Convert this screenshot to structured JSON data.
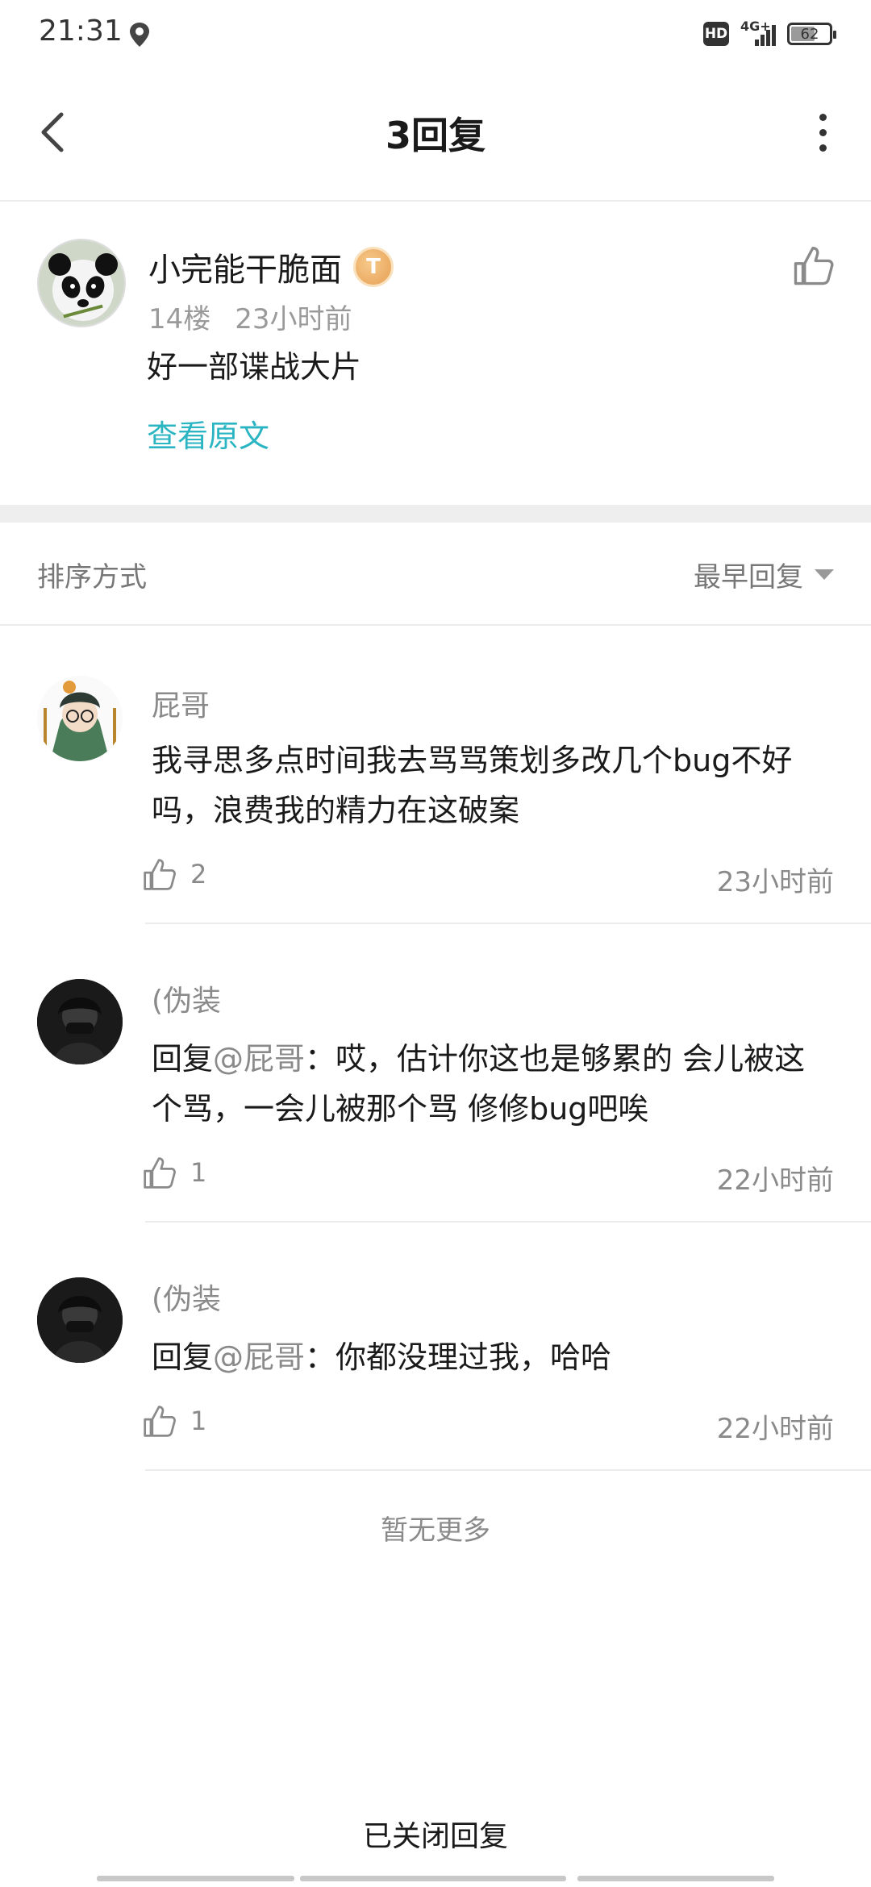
{
  "status_bar": {
    "time": "21:31",
    "location_icon": "location-pin-icon",
    "hd_label": "HD",
    "network_label": "4G+",
    "battery_level": 62,
    "battery_text": "62"
  },
  "header": {
    "title": "3回复",
    "back_icon": "chevron-left-icon",
    "more_icon": "more-vertical-icon"
  },
  "post": {
    "username": "小完能干脆面",
    "level_badge": "T",
    "floor": "14楼",
    "time": "23小时前",
    "content": "好一部谍战大片",
    "view_original": "查看原文"
  },
  "sort": {
    "label": "排序方式",
    "selected": "最早回复"
  },
  "replies": [
    {
      "username": "屁哥",
      "prefix": "",
      "mention": "",
      "content": "我寻思多点时间我去骂骂策划多改几个bug不好吗，浪费我的精力在这破案",
      "likes": "2",
      "time": "23小时前"
    },
    {
      "username": "(伪装",
      "prefix": "回复",
      "mention": "@屁哥",
      "content": "：哎，估计你这也是够累的 会儿被这个骂，一会儿被那个骂 修修bug吧唉",
      "likes": "1",
      "time": "22小时前"
    },
    {
      "username": "(伪装",
      "prefix": "回复",
      "mention": "@屁哥",
      "content": "：你都没理过我，哈哈",
      "likes": "1",
      "time": "22小时前"
    }
  ],
  "footer": {
    "no_more": "暂无更多",
    "closed": "已关闭回复"
  },
  "colors": {
    "accent": "#2bb5c2",
    "secondary_text": "#8a8a8a",
    "badge": "#e6a055"
  }
}
